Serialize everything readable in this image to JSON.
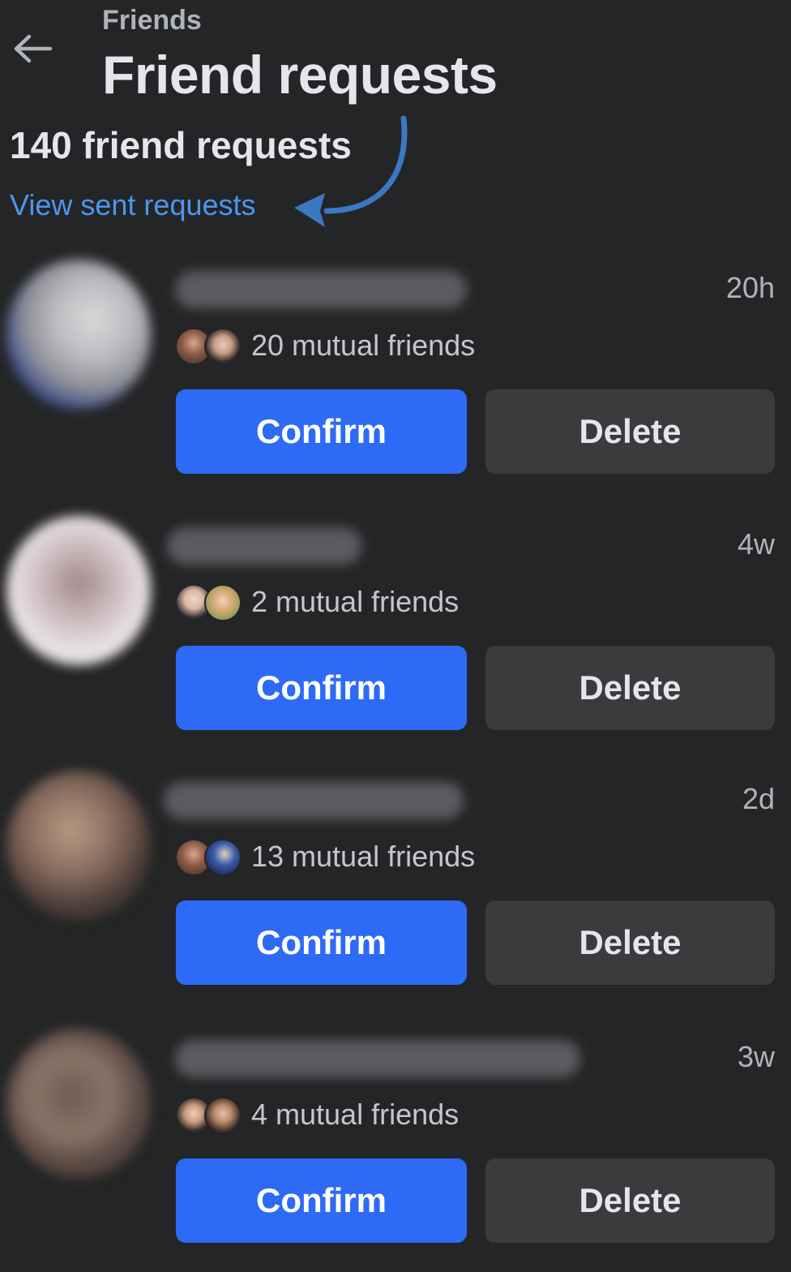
{
  "header": {
    "back_icon": "arrow-left-icon",
    "breadcrumb": "Friends",
    "title": "Friend requests"
  },
  "summary": {
    "count_text": "140 friend requests",
    "sent_link": "View sent requests"
  },
  "colors": {
    "background": "#242526",
    "confirm": "#2d6af5",
    "delete": "#3a3b3c",
    "link": "#4c96f0",
    "annotation_arrow": "#3a78c2"
  },
  "requests": [
    {
      "time": "20h",
      "mutual": "20 mutual friends",
      "confirm_label": "Confirm",
      "delete_label": "Delete"
    },
    {
      "time": "4w",
      "mutual": "2 mutual friends",
      "confirm_label": "Confirm",
      "delete_label": "Delete"
    },
    {
      "time": "2d",
      "mutual": "13 mutual friends",
      "confirm_label": "Confirm",
      "delete_label": "Delete"
    },
    {
      "time": "3w",
      "mutual": "4 mutual friends",
      "confirm_label": "Confirm",
      "delete_label": "Delete"
    }
  ]
}
